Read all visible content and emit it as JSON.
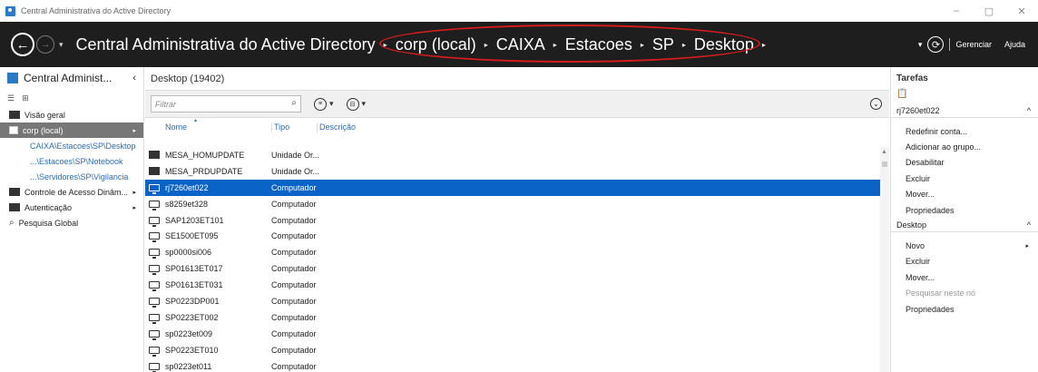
{
  "window": {
    "title": "Central Administrativa do Active Directory",
    "min_icon": "–",
    "max_icon": "▢",
    "close_icon": "✕"
  },
  "nav": {
    "back_icon": "←",
    "forward_icon": "→",
    "dropdown_icon": "▾",
    "breadcrumb": [
      "Central Administrativa do Active Directory",
      "corp (local)",
      "CAIXA",
      "Estacoes",
      "SP",
      "Desktop"
    ],
    "separator": "▸",
    "refresh_dropdown": "▾",
    "refresh_icon": "⟳",
    "gerenciar": "Gerenciar",
    "ajuda": "Ajuda",
    "annotation_color": "#d21c1c"
  },
  "left": {
    "header": "Central Administ...",
    "collapse_icon": "‹",
    "items": {
      "overview": "Visão geral",
      "corp": "corp (local)",
      "sub1": "CAIXA\\Estacoes\\SP\\Desktop",
      "sub2": "...\\Estacoes\\SP\\Notebook",
      "sub3": "...\\Servidores\\SP\\Vigilancia",
      "dac": "Controle de Acesso Dinâm...",
      "auth": "Autenticação",
      "search": "Pesquisa Global"
    },
    "arrow": "▸"
  },
  "center": {
    "header": "Desktop  (19402)",
    "filter_placeholder": "Filtrar",
    "search_icon": "⌕",
    "filter_btn1_icon": "≡",
    "filter_btn2_icon": "⊟",
    "dropdown": "▾",
    "expand_icon": "⌄",
    "columns": {
      "name": "Nome",
      "type": "Tipo",
      "desc": "Descrição",
      "sort_icon": "▴"
    },
    "rows": [
      {
        "name": "MESA_HOMUPDATE",
        "type": "Unidade Or...",
        "kind": "ou"
      },
      {
        "name": "MESA_PRDUPDATE",
        "type": "Unidade Or...",
        "kind": "ou"
      },
      {
        "name": "rj7260et022",
        "type": "Computador",
        "kind": "pc",
        "selected": true
      },
      {
        "name": "s8259et328",
        "type": "Computador",
        "kind": "pc"
      },
      {
        "name": "SAP1203ET101",
        "type": "Computador",
        "kind": "pc"
      },
      {
        "name": "SE1500ET095",
        "type": "Computador",
        "kind": "pc"
      },
      {
        "name": "sp0000si006",
        "type": "Computador",
        "kind": "pc"
      },
      {
        "name": "SP01613ET017",
        "type": "Computador",
        "kind": "pc"
      },
      {
        "name": "SP01613ET031",
        "type": "Computador",
        "kind": "pc"
      },
      {
        "name": "SP0223DP001",
        "type": "Computador",
        "kind": "pc"
      },
      {
        "name": "SP0223ET002",
        "type": "Computador",
        "kind": "pc"
      },
      {
        "name": "sp0223et009",
        "type": "Computador",
        "kind": "pc"
      },
      {
        "name": "SP0223ET010",
        "type": "Computador",
        "kind": "pc"
      },
      {
        "name": "sp0223et011",
        "type": "Computador",
        "kind": "pc"
      }
    ],
    "selection_color": "#0a64c8"
  },
  "tasks": {
    "header": "Tarefas",
    "clip_icon": "📋",
    "section1": "rj7260et022",
    "section1_actions": [
      "Redefinir conta...",
      "Adicionar ao grupo...",
      "Desabilitar",
      "Excluir",
      "Mover...",
      "Propriedades"
    ],
    "section2": "Desktop",
    "section2_actions": [
      "Novo",
      "Excluir",
      "Mover...",
      "Pesquisar neste nó",
      "Propriedades"
    ],
    "caret": "^",
    "submenu_arrow": "▸"
  }
}
